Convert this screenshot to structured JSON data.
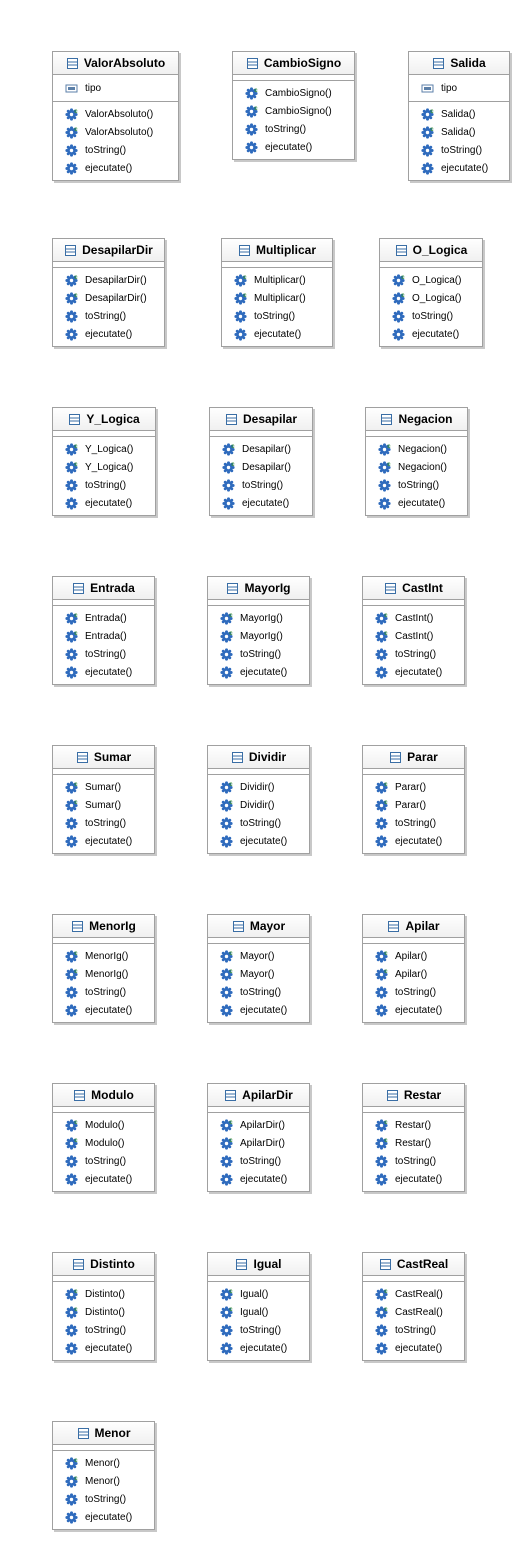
{
  "classes": [
    {
      "name": "ValorAbsoluto",
      "attributes": [
        "tipo"
      ],
      "methods": [
        {
          "label": "ValorAbsoluto()",
          "kind": "constructor"
        },
        {
          "label": "ValorAbsoluto()",
          "kind": "constructor"
        },
        {
          "label": "toString()",
          "kind": "method"
        },
        {
          "label": "ejecutate()",
          "kind": "method"
        }
      ]
    },
    {
      "name": "CambioSigno",
      "attributes": [],
      "methods": [
        {
          "label": "CambioSigno()",
          "kind": "constructor"
        },
        {
          "label": "CambioSigno()",
          "kind": "constructor"
        },
        {
          "label": "toString()",
          "kind": "method"
        },
        {
          "label": "ejecutate()",
          "kind": "method"
        }
      ]
    },
    {
      "name": "Salida",
      "attributes": [
        "tipo"
      ],
      "methods": [
        {
          "label": "Salida()",
          "kind": "constructor"
        },
        {
          "label": "Salida()",
          "kind": "constructor"
        },
        {
          "label": "toString()",
          "kind": "method"
        },
        {
          "label": "ejecutate()",
          "kind": "method"
        }
      ]
    },
    {
      "name": "DesapilarDir",
      "attributes": [],
      "methods": [
        {
          "label": "DesapilarDir()",
          "kind": "constructor"
        },
        {
          "label": "DesapilarDir()",
          "kind": "constructor"
        },
        {
          "label": "toString()",
          "kind": "method"
        },
        {
          "label": "ejecutate()",
          "kind": "method"
        }
      ]
    },
    {
      "name": "Multiplicar",
      "attributes": [],
      "methods": [
        {
          "label": "Multiplicar()",
          "kind": "constructor"
        },
        {
          "label": "Multiplicar()",
          "kind": "constructor"
        },
        {
          "label": "toString()",
          "kind": "method"
        },
        {
          "label": "ejecutate()",
          "kind": "method"
        }
      ]
    },
    {
      "name": "O_Logica",
      "attributes": [],
      "methods": [
        {
          "label": "O_Logica()",
          "kind": "constructor"
        },
        {
          "label": "O_Logica()",
          "kind": "constructor"
        },
        {
          "label": "toString()",
          "kind": "method"
        },
        {
          "label": "ejecutate()",
          "kind": "method"
        }
      ]
    },
    {
      "name": "Y_Logica",
      "attributes": [],
      "methods": [
        {
          "label": "Y_Logica()",
          "kind": "constructor"
        },
        {
          "label": "Y_Logica()",
          "kind": "constructor"
        },
        {
          "label": "toString()",
          "kind": "method"
        },
        {
          "label": "ejecutate()",
          "kind": "method"
        }
      ]
    },
    {
      "name": "Desapilar",
      "attributes": [],
      "methods": [
        {
          "label": "Desapilar()",
          "kind": "constructor"
        },
        {
          "label": "Desapilar()",
          "kind": "constructor"
        },
        {
          "label": "toString()",
          "kind": "method"
        },
        {
          "label": "ejecutate()",
          "kind": "method"
        }
      ]
    },
    {
      "name": "Negacion",
      "attributes": [],
      "methods": [
        {
          "label": "Negacion()",
          "kind": "constructor"
        },
        {
          "label": "Negacion()",
          "kind": "constructor"
        },
        {
          "label": "toString()",
          "kind": "method"
        },
        {
          "label": "ejecutate()",
          "kind": "method"
        }
      ]
    },
    {
      "name": "Entrada",
      "attributes": [],
      "methods": [
        {
          "label": "Entrada()",
          "kind": "constructor"
        },
        {
          "label": "Entrada()",
          "kind": "constructor"
        },
        {
          "label": "toString()",
          "kind": "method"
        },
        {
          "label": "ejecutate()",
          "kind": "method"
        }
      ]
    },
    {
      "name": "MayorIg",
      "attributes": [],
      "methods": [
        {
          "label": "MayorIg()",
          "kind": "constructor"
        },
        {
          "label": "MayorIg()",
          "kind": "constructor"
        },
        {
          "label": "toString()",
          "kind": "method"
        },
        {
          "label": "ejecutate()",
          "kind": "method"
        }
      ]
    },
    {
      "name": "CastInt",
      "attributes": [],
      "methods": [
        {
          "label": "CastInt()",
          "kind": "constructor"
        },
        {
          "label": "CastInt()",
          "kind": "constructor"
        },
        {
          "label": "toString()",
          "kind": "method"
        },
        {
          "label": "ejecutate()",
          "kind": "method"
        }
      ]
    },
    {
      "name": "Sumar",
      "attributes": [],
      "methods": [
        {
          "label": "Sumar()",
          "kind": "constructor"
        },
        {
          "label": "Sumar()",
          "kind": "constructor"
        },
        {
          "label": "toString()",
          "kind": "method"
        },
        {
          "label": "ejecutate()",
          "kind": "method"
        }
      ]
    },
    {
      "name": "Dividir",
      "attributes": [],
      "methods": [
        {
          "label": "Dividir()",
          "kind": "constructor"
        },
        {
          "label": "Dividir()",
          "kind": "constructor"
        },
        {
          "label": "toString()",
          "kind": "method"
        },
        {
          "label": "ejecutate()",
          "kind": "method"
        }
      ]
    },
    {
      "name": "Parar",
      "attributes": [],
      "methods": [
        {
          "label": "Parar()",
          "kind": "constructor"
        },
        {
          "label": "Parar()",
          "kind": "constructor"
        },
        {
          "label": "toString()",
          "kind": "method"
        },
        {
          "label": "ejecutate()",
          "kind": "method"
        }
      ]
    },
    {
      "name": "MenorIg",
      "attributes": [],
      "methods": [
        {
          "label": "MenorIg()",
          "kind": "constructor"
        },
        {
          "label": "MenorIg()",
          "kind": "constructor"
        },
        {
          "label": "toString()",
          "kind": "method"
        },
        {
          "label": "ejecutate()",
          "kind": "method"
        }
      ]
    },
    {
      "name": "Mayor",
      "attributes": [],
      "methods": [
        {
          "label": "Mayor()",
          "kind": "constructor"
        },
        {
          "label": "Mayor()",
          "kind": "constructor"
        },
        {
          "label": "toString()",
          "kind": "method"
        },
        {
          "label": "ejecutate()",
          "kind": "method"
        }
      ]
    },
    {
      "name": "Apilar",
      "attributes": [],
      "methods": [
        {
          "label": "Apilar()",
          "kind": "constructor"
        },
        {
          "label": "Apilar()",
          "kind": "constructor"
        },
        {
          "label": "toString()",
          "kind": "method"
        },
        {
          "label": "ejecutate()",
          "kind": "method"
        }
      ]
    },
    {
      "name": "Modulo",
      "attributes": [],
      "methods": [
        {
          "label": "Modulo()",
          "kind": "constructor"
        },
        {
          "label": "Modulo()",
          "kind": "constructor"
        },
        {
          "label": "toString()",
          "kind": "method"
        },
        {
          "label": "ejecutate()",
          "kind": "method"
        }
      ]
    },
    {
      "name": "ApilarDir",
      "attributes": [],
      "methods": [
        {
          "label": "ApilarDir()",
          "kind": "constructor"
        },
        {
          "label": "ApilarDir()",
          "kind": "constructor"
        },
        {
          "label": "toString()",
          "kind": "method"
        },
        {
          "label": "ejecutate()",
          "kind": "method"
        }
      ]
    },
    {
      "name": "Restar",
      "attributes": [],
      "methods": [
        {
          "label": "Restar()",
          "kind": "constructor"
        },
        {
          "label": "Restar()",
          "kind": "constructor"
        },
        {
          "label": "toString()",
          "kind": "method"
        },
        {
          "label": "ejecutate()",
          "kind": "method"
        }
      ]
    },
    {
      "name": "Distinto",
      "attributes": [],
      "methods": [
        {
          "label": "Distinto()",
          "kind": "constructor"
        },
        {
          "label": "Distinto()",
          "kind": "constructor"
        },
        {
          "label": "toString()",
          "kind": "method"
        },
        {
          "label": "ejecutate()",
          "kind": "method"
        }
      ]
    },
    {
      "name": "Igual",
      "attributes": [],
      "methods": [
        {
          "label": "Igual()",
          "kind": "constructor"
        },
        {
          "label": "Igual()",
          "kind": "constructor"
        },
        {
          "label": "toString()",
          "kind": "method"
        },
        {
          "label": "ejecutate()",
          "kind": "method"
        }
      ]
    },
    {
      "name": "CastReal",
      "attributes": [],
      "methods": [
        {
          "label": "CastReal()",
          "kind": "constructor"
        },
        {
          "label": "CastReal()",
          "kind": "constructor"
        },
        {
          "label": "toString()",
          "kind": "method"
        },
        {
          "label": "ejecutate()",
          "kind": "method"
        }
      ]
    },
    {
      "name": "Menor",
      "attributes": [],
      "methods": [
        {
          "label": "Menor()",
          "kind": "constructor"
        },
        {
          "label": "Menor()",
          "kind": "constructor"
        },
        {
          "label": "toString()",
          "kind": "method"
        },
        {
          "label": "ejecutate()",
          "kind": "method"
        }
      ]
    }
  ],
  "colors": {
    "border": "#a0a0a0",
    "class_icon": "#3a6ea5",
    "method_icon": "#2f6bbd",
    "constructor_badge": "#2e8b2e",
    "field_icon": "#5b7fa8"
  },
  "icons": {
    "class": "class-icon",
    "field": "field-icon",
    "method": "method-gear-icon",
    "constructor": "constructor-gear-icon"
  }
}
